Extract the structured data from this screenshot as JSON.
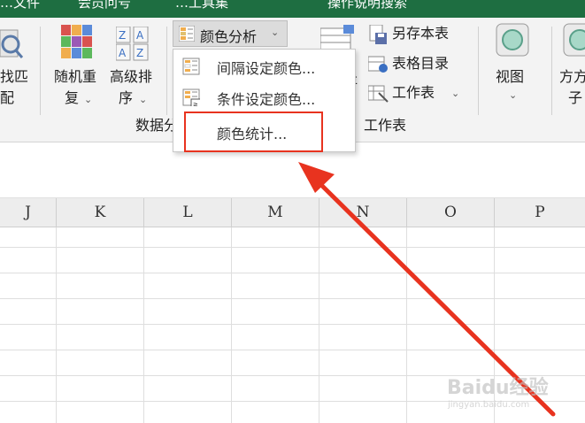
{
  "title_bar": {
    "fragments": [
      "…文件",
      "会员问号",
      "…工具集",
      "操作说明搜索"
    ]
  },
  "ribbon": {
    "left_partial_label_line1": "找匹",
    "left_partial_label_line2": "配",
    "random_repeat": {
      "line1": "随机重",
      "line2": "复"
    },
    "advanced_sort": {
      "line1": "高级排",
      "line2": "序"
    },
    "color_analysis_button": "颜色分析",
    "data_group_label": "数据分",
    "worksheet_group_label": "工作表",
    "partial_table_label": "存",
    "save_this_sheet": "另存本表",
    "sheet_directory": "表格目录",
    "worksheet_menu": "工作表",
    "view_label": "视图",
    "square_label_line1": "方方",
    "square_label_line2": "子"
  },
  "dropdown": {
    "items": [
      {
        "label": "间隔设定颜色..."
      },
      {
        "label": "条件设定颜色..."
      },
      {
        "label": "颜色统计..."
      }
    ]
  },
  "columns": [
    "J",
    "K",
    "L",
    "M",
    "N",
    "O",
    "P"
  ],
  "watermark": {
    "text": "Baidu经验",
    "sub": "jingyan.baidu.com"
  },
  "colors": {
    "title_bar": "#1e6e41",
    "ribbon_bg": "#f3f3f3",
    "highlight": "#e8331f",
    "arrow": "#e8331f"
  }
}
